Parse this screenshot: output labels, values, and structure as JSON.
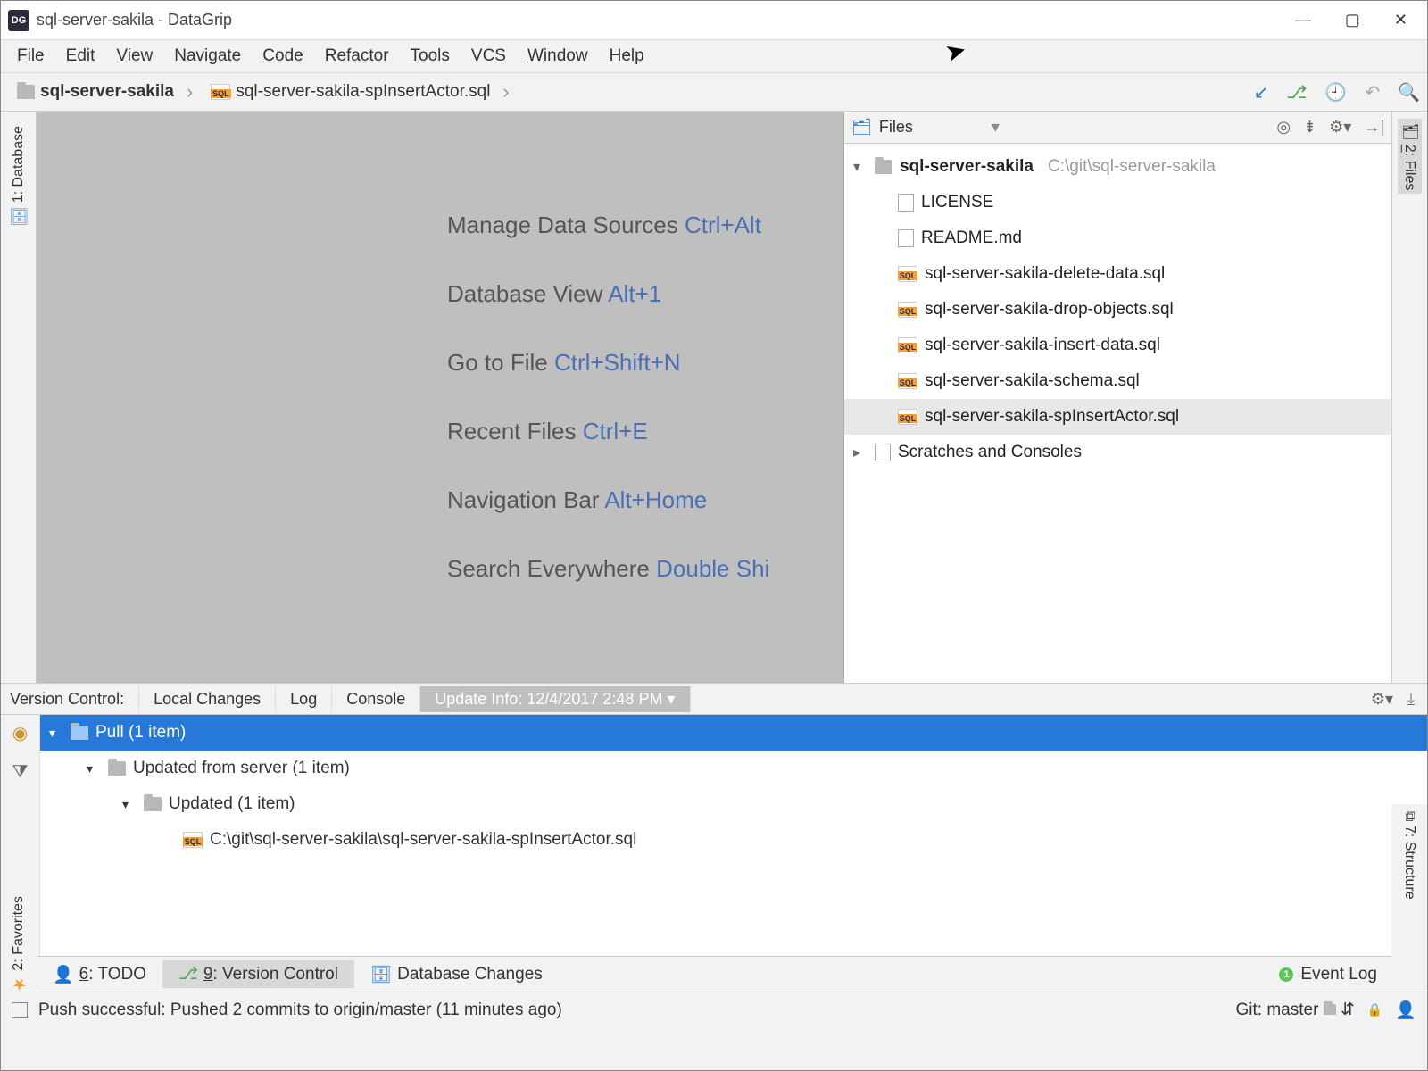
{
  "window": {
    "title": "sql-server-sakila - DataGrip"
  },
  "menu": [
    "File",
    "Edit",
    "View",
    "Navigate",
    "Code",
    "Refactor",
    "Tools",
    "VCS",
    "Window",
    "Help"
  ],
  "breadcrumb": {
    "root": "sql-server-sakila",
    "file": "sql-server-sakila-spInsertActor.sql"
  },
  "left_toolwindow": {
    "database_label": "1: Database"
  },
  "right_toolwindow": {
    "files_label": "2: Files",
    "structure_label": "7: Structure"
  },
  "hints": [
    {
      "label": "Manage Data Sources",
      "shortcut": "Ctrl+Alt"
    },
    {
      "label": "Database View",
      "shortcut": "Alt+1"
    },
    {
      "label": "Go to File",
      "shortcut": "Ctrl+Shift+N"
    },
    {
      "label": "Recent Files",
      "shortcut": "Ctrl+E"
    },
    {
      "label": "Navigation Bar",
      "shortcut": "Alt+Home"
    },
    {
      "label": "Search Everywhere",
      "shortcut": "Double Shi"
    }
  ],
  "files_panel": {
    "header": "Files",
    "project": {
      "name": "sql-server-sakila",
      "path": "C:\\git\\sql-server-sakila"
    },
    "items": [
      {
        "name": "LICENSE",
        "type": "file"
      },
      {
        "name": "README.md",
        "type": "file"
      },
      {
        "name": "sql-server-sakila-delete-data.sql",
        "type": "sql"
      },
      {
        "name": "sql-server-sakila-drop-objects.sql",
        "type": "sql"
      },
      {
        "name": "sql-server-sakila-insert-data.sql",
        "type": "sql"
      },
      {
        "name": "sql-server-sakila-schema.sql",
        "type": "sql"
      },
      {
        "name": "sql-server-sakila-spInsertActor.sql",
        "type": "sql",
        "selected": true
      }
    ],
    "scratches": "Scratches and Consoles"
  },
  "vcs": {
    "title": "Version Control:",
    "tabs": [
      "Local Changes",
      "Log",
      "Console"
    ],
    "update_info": "Update Info: 12/4/2017 2:48 PM",
    "tree": {
      "pull": "Pull (1 item)",
      "updated_from_server": "Updated from server (1 item)",
      "updated": "Updated (1 item)",
      "file": "C:\\git\\sql-server-sakila\\sql-server-sakila-spInsertActor.sql"
    }
  },
  "bottom_tabs": {
    "todo": "6: TODO",
    "version_control": "9: Version Control",
    "db_changes": "Database Changes",
    "event_log": "Event Log",
    "event_count": "1"
  },
  "left_favorites": "2: Favorites",
  "status": {
    "message": "Push successful: Pushed 2 commits to origin/master (11 minutes ago)",
    "git": "Git: master"
  }
}
